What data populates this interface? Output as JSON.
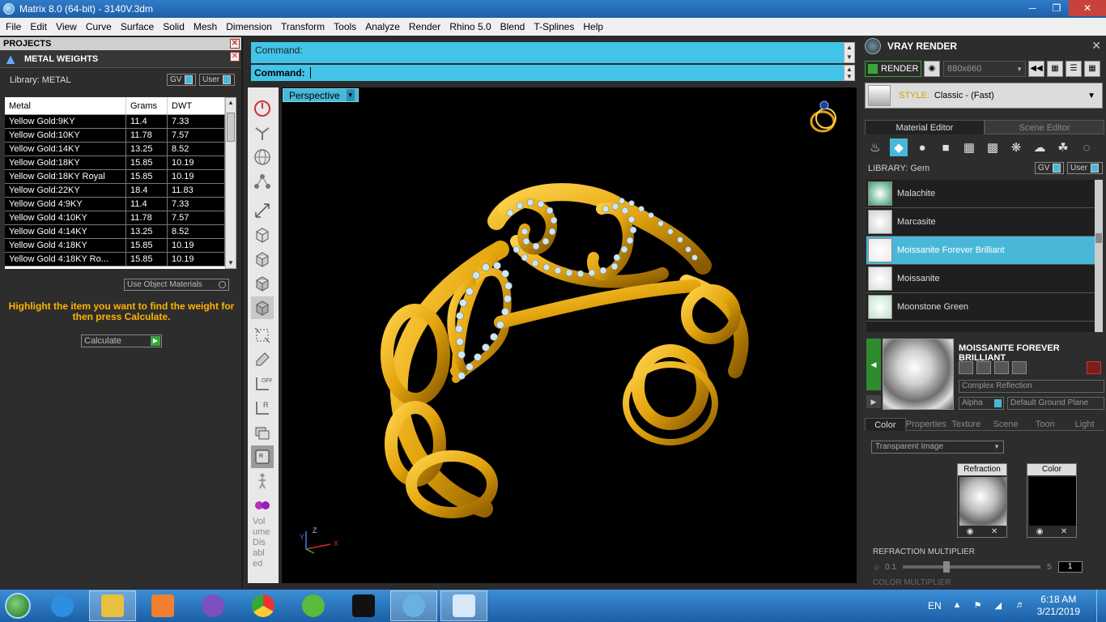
{
  "window": {
    "title": "Matrix 8.0 (64-bit) - 3140V.3dm"
  },
  "menu": [
    "File",
    "Edit",
    "View",
    "Curve",
    "Surface",
    "Solid",
    "Mesh",
    "Dimension",
    "Transform",
    "Tools",
    "Analyze",
    "Render",
    "Rhino 5.0",
    "Blend",
    "T-Splines",
    "Help"
  ],
  "left": {
    "projects_title": "PROJECTS",
    "panel_title": "METAL WEIGHTS",
    "library_label": "Library: METAL",
    "gv_label": "GV",
    "user_label": "User",
    "columns": [
      "Metal",
      "Grams",
      "DWT"
    ],
    "rows": [
      [
        "Yellow Gold:9KY",
        "11.4",
        "7.33"
      ],
      [
        "Yellow Gold:10KY",
        "11.78",
        "7.57"
      ],
      [
        "Yellow Gold:14KY",
        "13.25",
        "8.52"
      ],
      [
        "Yellow Gold:18KY",
        "15.85",
        "10.19"
      ],
      [
        "Yellow Gold:18KY Royal",
        "15.85",
        "10.19"
      ],
      [
        "Yellow Gold:22KY",
        "18.4",
        "11.83"
      ],
      [
        "Yellow Gold 4:9KY",
        "11.4",
        "7.33"
      ],
      [
        "Yellow Gold 4:10KY",
        "11.78",
        "7.57"
      ],
      [
        "Yellow Gold 4:14KY",
        "13.25",
        "8.52"
      ],
      [
        "Yellow Gold 4:18KY",
        "15.85",
        "10.19"
      ],
      [
        "Yellow Gold 4:18KY Ro...",
        "15.85",
        "10.19"
      ]
    ],
    "use_object_materials": "Use Object Materials",
    "instruction": "Highlight the item you want to find the weight for then press Calculate.",
    "calculate_label": "Calculate"
  },
  "command": {
    "line1_label": "Command:",
    "line2_label": "Command:"
  },
  "viewport": {
    "view_name": "Perspective",
    "volume_text": "Vol ume Dis abl ed"
  },
  "right": {
    "title": "VRAY RENDER",
    "render_label": "RENDER",
    "resolution": "880x660",
    "style_label": "STYLE:",
    "style_value": "Classic - (Fast)",
    "tabs": [
      "Material Editor",
      "Scene Editor"
    ],
    "library_label": "LIBRARY: Gem",
    "gv_label": "GV",
    "user_label": "User",
    "materials": [
      {
        "name": "Malachite",
        "swatch": "#3a9a6a"
      },
      {
        "name": "Marcasite",
        "swatch": "#cfcfcf"
      },
      {
        "name": "Moissanite Forever Brilliant",
        "swatch": "#e8e8e8",
        "selected": true
      },
      {
        "name": "Moissanite",
        "swatch": "#dcdcdc"
      },
      {
        "name": "Moonstone Green",
        "swatch": "#bfe0c9"
      }
    ],
    "preview_name": "MOISSANITE FOREVER BRILLIANT",
    "complex_reflection": "Complex Reflection",
    "alpha_label": "Alpha",
    "ground_plane": "Default Ground Plane",
    "prop_tabs": [
      "Color",
      "Properties",
      "Texture",
      "Scene",
      "Toon",
      "Light"
    ],
    "transparent_image": "Transparent Image",
    "refraction_label": "Refraction",
    "color_label": "Color",
    "refraction_multiplier": "REFRACTION MULTIPLIER",
    "slider_min": "0.1",
    "slider_max": "5",
    "slider_value": "1",
    "color_multiplier": "COLOR MULTIPLIER"
  },
  "taskbar": {
    "language": "EN",
    "time": "6:18 AM",
    "date": "3/21/2019"
  }
}
